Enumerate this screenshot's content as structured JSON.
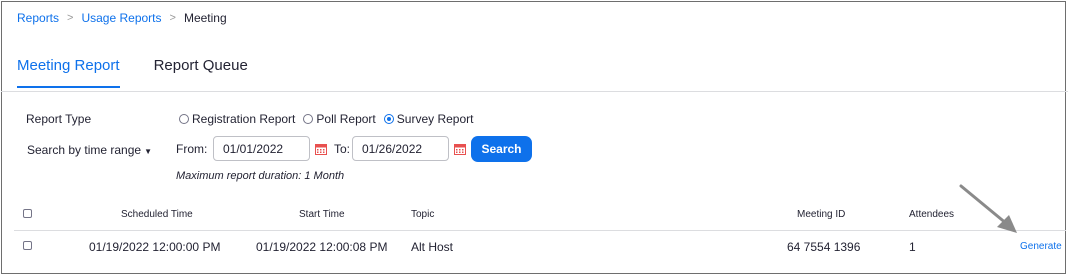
{
  "breadcrumb": {
    "items": [
      "Reports",
      "Usage Reports",
      "Meeting"
    ],
    "separator": ">"
  },
  "tabs": [
    {
      "label": "Meeting Report",
      "active": true
    },
    {
      "label": "Report Queue",
      "active": false
    }
  ],
  "filters": {
    "report_type_label": "Report Type",
    "report_types": [
      {
        "label": "Registration Report",
        "checked": false
      },
      {
        "label": "Poll Report",
        "checked": false
      },
      {
        "label": "Survey Report",
        "checked": true
      }
    ],
    "search_by_label": "Search by time range",
    "from_label": "From:",
    "from_value": "01/01/2022",
    "to_label": "To:",
    "to_value": "01/26/2022",
    "search_button": "Search",
    "note": "Maximum report duration: 1 Month"
  },
  "table": {
    "headers": [
      "Scheduled Time",
      "Start Time",
      "Topic",
      "Meeting ID",
      "Attendees"
    ],
    "rows": [
      {
        "scheduled_time": "01/19/2022 12:00:00 PM",
        "start_time": "01/19/2022 12:00:08 PM",
        "topic": "Alt Host",
        "meeting_id": "64 7554 1396",
        "attendees": "1",
        "action": "Generate"
      }
    ]
  },
  "colors": {
    "accent": "#0e71eb",
    "calendar_icon": "#e8504f",
    "annotation_arrow": "#8a8a8a"
  },
  "icons": [
    "calendar-icon",
    "caret-down-icon",
    "annotation-arrow"
  ]
}
